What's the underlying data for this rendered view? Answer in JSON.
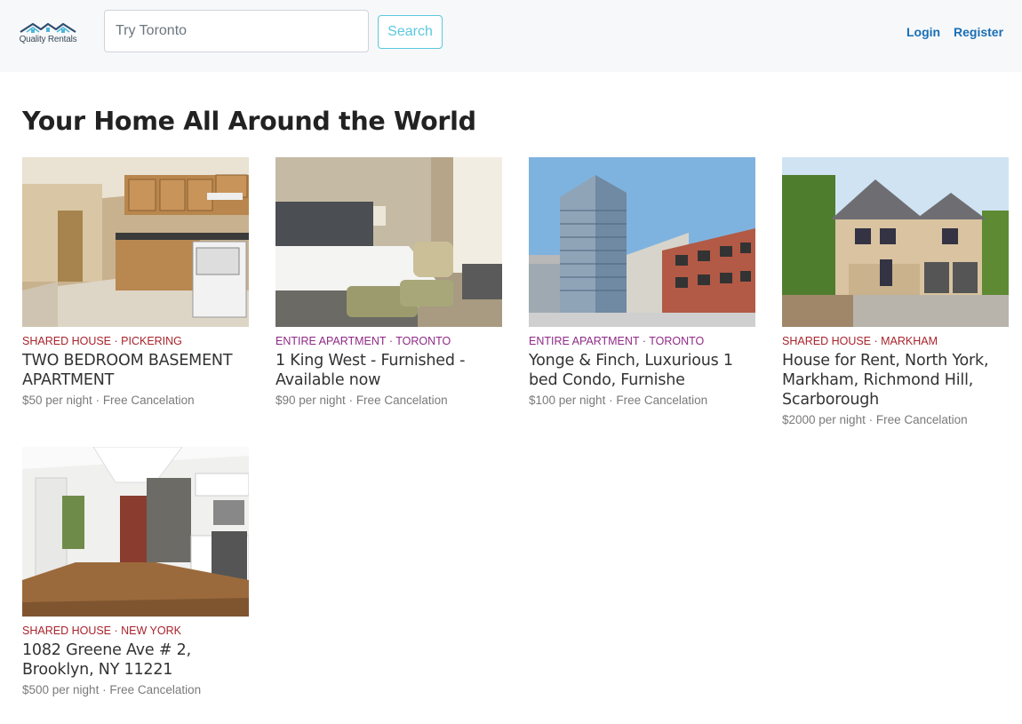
{
  "brand": {
    "name": "Quality Rentals"
  },
  "search": {
    "placeholder": "Try Toronto",
    "button_label": "Search"
  },
  "nav": {
    "login": "Login",
    "register": "Register"
  },
  "page": {
    "title": "Your Home All Around the World"
  },
  "listings": [
    {
      "type": "SHARED HOUSE",
      "city": "PICKERING",
      "title": "TWO BEDROOM BASEMENT APARTMENT",
      "price": "$50 per night",
      "cancel": "Free Cancelation",
      "meta_color": "#a8232b"
    },
    {
      "type": "ENTIRE APARTMENT",
      "city": "TORONTO",
      "title": "1 King West - Furnished - Available now",
      "price": "$90 per night",
      "cancel": "Free Cancelation",
      "meta_color": "#8e2a86"
    },
    {
      "type": "ENTIRE APARTMENT",
      "city": "TORONTO",
      "title": "Yonge & Finch, Luxurious 1 bed Condo, Furnishe",
      "price": "$100 per night",
      "cancel": "Free Cancelation",
      "meta_color": "#8e2a86"
    },
    {
      "type": "SHARED HOUSE",
      "city": "MARKHAM",
      "title": "House for Rent, North York, Markham, Richmond Hill, Scarborough",
      "price": "$2000 per night",
      "cancel": "Free Cancelation",
      "meta_color": "#a8232b"
    },
    {
      "type": "SHARED HOUSE",
      "city": "NEW YORK",
      "title": "1082 Greene Ave # 2, Brooklyn, NY 11221",
      "price": "$500 per night",
      "cancel": "Free Cancelation",
      "meta_color": "#a8232b"
    }
  ]
}
